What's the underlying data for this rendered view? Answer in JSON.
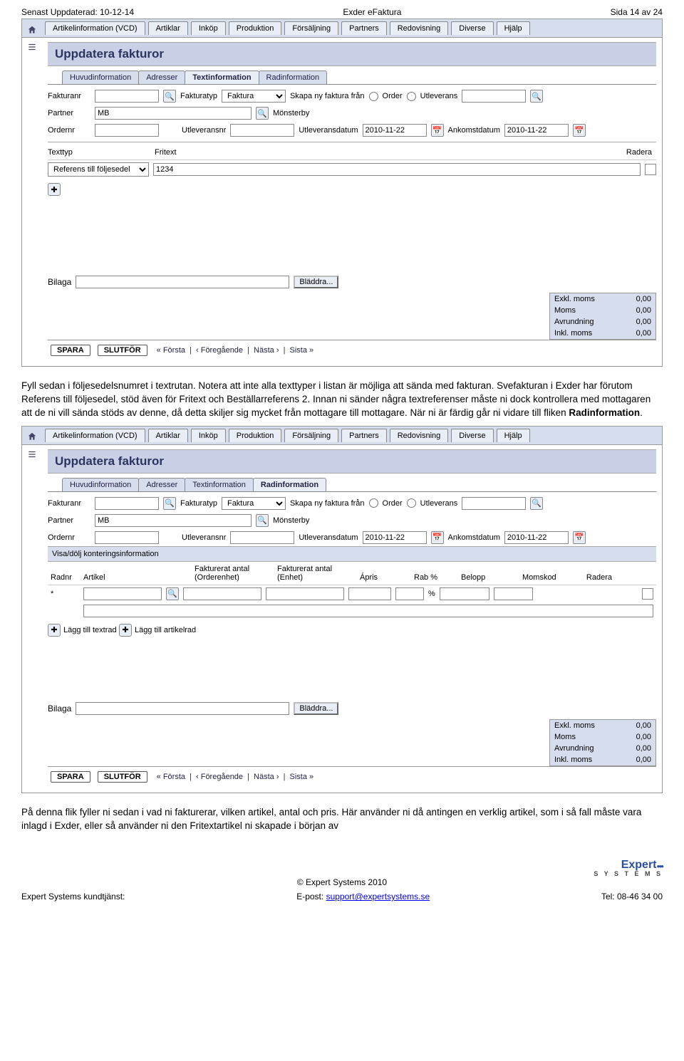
{
  "header": {
    "left": "Senast Uppdaterad: 10-12-14",
    "center": "Exder eFaktura",
    "right": "Sida 14 av 24"
  },
  "nav": {
    "items": [
      "Artikelinformation (VCD)",
      "Artiklar",
      "Inköp",
      "Produktion",
      "Försäljning",
      "Partners",
      "Redovisning",
      "Diverse",
      "Hjälp"
    ]
  },
  "title": "Uppdatera fakturor",
  "subtabs": [
    "Huvudinformation",
    "Adresser",
    "Textinformation",
    "Radinformation"
  ],
  "form_labels": {
    "fakturanr": "Fakturanr",
    "fakturatyp": "Fakturatyp",
    "skapa": "Skapa ny faktura från",
    "order": "Order",
    "utlev": "Utleverans",
    "partner": "Partner",
    "monsterby": "Mönsterby",
    "ordernr": "Ordernr",
    "utlevnr": "Utleveransnr",
    "utlevdatum": "Utleveransdatum",
    "ankomst": "Ankomstdatum"
  },
  "form_values": {
    "fakturatyp": "Faktura",
    "partner": "MB",
    "utlevdatum": "2010-11-22",
    "ankomst": "2010-11-22"
  },
  "text_table": {
    "head_texttyp": "Texttyp",
    "head_fritext": "Fritext",
    "head_radera": "Radera",
    "texttyp_value": "Referens till följesedel",
    "fritext_value": "1234"
  },
  "bilaga": {
    "label": "Bilaga",
    "browse": "Bläddra..."
  },
  "totals": {
    "exkl_label": "Exkl. moms",
    "exkl": "0,00",
    "moms_label": "Moms",
    "moms": "0,00",
    "avr_label": "Avrundning",
    "avr": "0,00",
    "inkl_label": "Inkl. moms",
    "inkl": "0,00"
  },
  "footer_btns": {
    "spara": "SPARA",
    "slutfor": "SLUTFÖR"
  },
  "paging": {
    "forsta": "« Första",
    "foreg": "‹ Föregående",
    "nasta": "Nästa ›",
    "sista": "Sista »",
    "sep": " | "
  },
  "para1": "Fyll sedan i följesedelsnumret i textrutan. Notera att inte alla texttyper i listan är möjliga att sända med fakturan. Svefakturan i Exder har förutom Referens till följesedel, stöd även för Fritext och Beställarreferens 2. Innan ni sänder några textreferenser måste ni dock kontrollera med mottagaren att de ni vill sända stöds av denne, då detta skiljer sig mycket från mottagare till mottagare. När ni är färdig går ni vidare till fliken ",
  "para1_bold": "Radinformation",
  "para1_end": ".",
  "konthead": "Visa/dölj konteringsinformation",
  "line_head": {
    "radnr": "Radnr",
    "artikel": "Artikel",
    "fa1a": "Fakturerat antal",
    "fa1b": "(Orderenhet)",
    "fa2a": "Fakturerat antal",
    "fa2b": "(Enhet)",
    "apris": "Ápris",
    "rab": "Rab %",
    "belopp": "Belopp",
    "momskod": "Momskod",
    "radera": "Radera"
  },
  "line_row": {
    "radnr": "*",
    "pct": "%"
  },
  "add_text": "Lägg till textrad",
  "add_article": "Lägg till artikelrad",
  "para2": "På denna flik fyller ni sedan i vad ni fakturerar, vilken artikel, antal och pris. Här använder ni då antingen en verklig artikel, som i så fall måste vara inlagd i Exder, eller så använder ni den Fritextartikel ni skapade i början av",
  "footer": {
    "copyright": "© Expert Systems 2010",
    "kundtjanst": "Expert Systems kundtjänst:",
    "epost_label": "E-post: ",
    "epost": "support@expertsystems.se",
    "tel": "Tel: 08-46 34 00",
    "logo_top": "Expert",
    "logo_bottom": "S Y S T E M S"
  }
}
